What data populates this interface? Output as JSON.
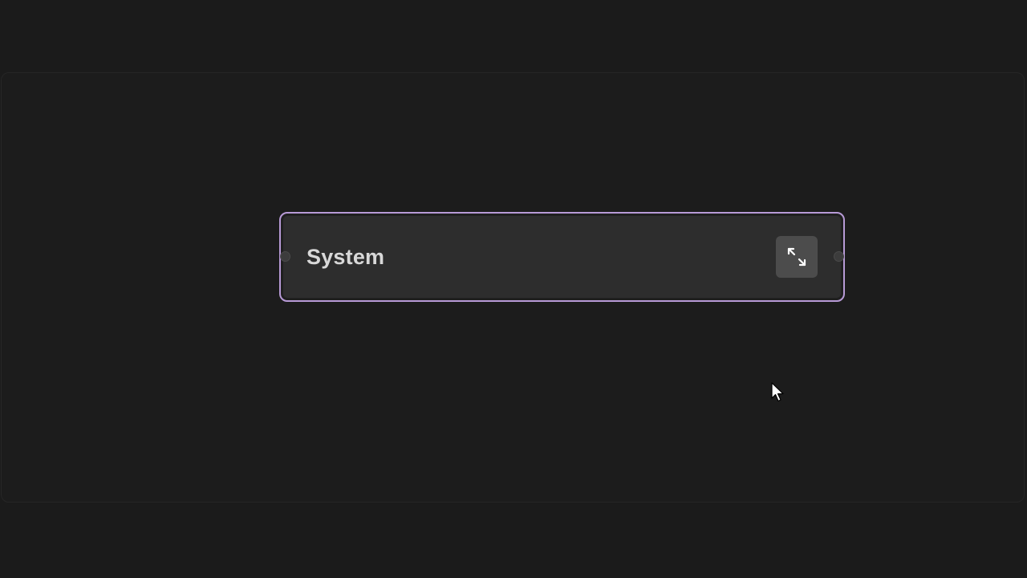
{
  "node": {
    "label": "System",
    "expand_icon": "expand-arrows-icon",
    "border_color": "#b79ad6"
  },
  "icons": {
    "cursor": "mouse-pointer-icon"
  }
}
